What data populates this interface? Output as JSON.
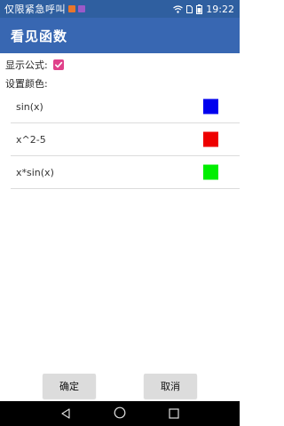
{
  "status_bar": {
    "carrier": "仅限紧急呼叫",
    "notif_colors": [
      "#e8762c",
      "#9b59c8"
    ],
    "time": "19:22",
    "icons": [
      "wifi-icon",
      "sim-icon",
      "battery-icon"
    ]
  },
  "app_bar": {
    "title": "看见函数"
  },
  "settings": {
    "show_formula_label": "显示公式:",
    "show_formula_checked": true,
    "color_setting_label": "设置颜色:"
  },
  "functions": [
    {
      "label": "sin(x)",
      "color": "#0000ee"
    },
    {
      "label": "x^2-5",
      "color": "#ee0000"
    },
    {
      "label": "x*sin(x)",
      "color": "#00ee00"
    }
  ],
  "buttons": {
    "ok": "确定",
    "cancel": "取消"
  },
  "nav_bar": {
    "icons": [
      "back-icon",
      "home-icon",
      "recents-icon"
    ]
  }
}
